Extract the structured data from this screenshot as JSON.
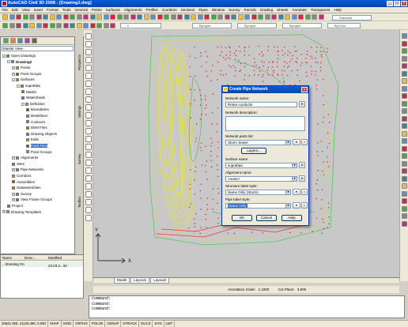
{
  "window": {
    "title": "AutoCAD Civil 3D 2008 - [Drawing2.dwg]"
  },
  "menu": [
    "File",
    "Edit",
    "View",
    "Insert",
    "Format",
    "Tools",
    "General",
    "Points",
    "Surfaces",
    "Alignments",
    "Profiles",
    "Corridors",
    "Sections",
    "Pipes",
    "Window",
    "Survey",
    "Parcels",
    "Grading",
    "Sheets",
    "Annotate",
    "Transparent",
    "Help"
  ],
  "toolbar": {
    "layer_combo": "0",
    "bylayer1": "ByLayer",
    "bylayer2": "ByLayer",
    "bylayer3": "ByLayer",
    "bycolor": "ByColor",
    "style_combo": "Standard",
    "layer_state": "- (none) -"
  },
  "prospector": {
    "view_select": "Master View",
    "tree": [
      {
        "label": "Open Drawings",
        "level": 0,
        "exp": "-"
      },
      {
        "label": "Drawing2",
        "level": 1,
        "exp": "-",
        "bold": true
      },
      {
        "label": "Points",
        "level": 2,
        "exp": "+"
      },
      {
        "label": "Point Groups",
        "level": 2,
        "exp": "+"
      },
      {
        "label": "Surfaces",
        "level": 2,
        "exp": "-"
      },
      {
        "label": "suprafata",
        "level": 3,
        "exp": "-"
      },
      {
        "label": "Masks",
        "level": 4,
        "exp": ""
      },
      {
        "label": "Watersheds",
        "level": 4,
        "exp": ""
      },
      {
        "label": "Definition",
        "level": 4,
        "exp": "-"
      },
      {
        "label": "Boundaries",
        "level": 5,
        "exp": ""
      },
      {
        "label": "Breaklines",
        "level": 5,
        "exp": ""
      },
      {
        "label": "Contours",
        "level": 5,
        "exp": ""
      },
      {
        "label": "DEM Files",
        "level": 5,
        "exp": ""
      },
      {
        "label": "Drawing Objects",
        "level": 5,
        "exp": ""
      },
      {
        "label": "Edits",
        "level": 5,
        "exp": ""
      },
      {
        "label": "Point Files",
        "level": 5,
        "exp": "",
        "selected": true
      },
      {
        "label": "Point Groups",
        "level": 5,
        "exp": ""
      },
      {
        "label": "Alignments",
        "level": 2,
        "exp": "+"
      },
      {
        "label": "Sites",
        "level": 2,
        "exp": ""
      },
      {
        "label": "Pipe Networks",
        "level": 2,
        "exp": "+"
      },
      {
        "label": "Corridors",
        "level": 2,
        "exp": ""
      },
      {
        "label": "Assemblies",
        "level": 2,
        "exp": ""
      },
      {
        "label": "Subassemblies",
        "level": 2,
        "exp": ""
      },
      {
        "label": "Survey",
        "level": 2,
        "exp": "+"
      },
      {
        "label": "View Frame Groups",
        "level": 2,
        "exp": "+"
      },
      {
        "label": "Project",
        "level": 1,
        "exp": ""
      },
      {
        "label": "Drawing Templates",
        "level": 0,
        "exp": "+"
      }
    ],
    "vtabs": [
      "Prospector",
      "Settings",
      "Survey",
      "Toolbox"
    ],
    "lower": {
      "col_name": "Name",
      "col_desc": "Desc...",
      "col_mod": "Modified",
      "row_name": "...\\Existing Grou",
      "row_desc": "",
      "row_mod": "23.03.2...32"
    }
  },
  "layout_tabs": [
    "Model",
    "Layout1",
    "Layout2"
  ],
  "annotation": {
    "scale_label": "Annotation Scale:",
    "scale": "1:1000",
    "cutplane_label": "Cut Plane:",
    "cutplane": "3.500"
  },
  "command_lines": [
    "Command:",
    "Command:",
    "Command:"
  ],
  "status": {
    "coords": "26621.050, 21129.490, 0.000",
    "buttons": [
      "SNAP",
      "GRID",
      "ORTHO",
      "POLAR",
      "OSNAP",
      "OTRACK",
      "DUCS",
      "DYN",
      "LWT"
    ]
  },
  "dialog": {
    "title": "Create Pipe Network",
    "network_name_label": "Network name:",
    "network_name": "Retea conducte",
    "description_label": "Network description:",
    "description": "",
    "parts_list_label": "Network parts list:",
    "parts_list": "Storm Sewer",
    "layers_button": "Layers...",
    "surface_label": "Surface name:",
    "surface": "suprafata",
    "alignment_label": "Alignment name:",
    "alignment": "<none>",
    "structure_label": "Structure label style:",
    "structure_style": "Name Only (Storm)",
    "pipe_label": "Pipe label style:",
    "pipe_style": "Name Only",
    "ok": "OK",
    "cancel": "Cancel",
    "help": "Help"
  }
}
